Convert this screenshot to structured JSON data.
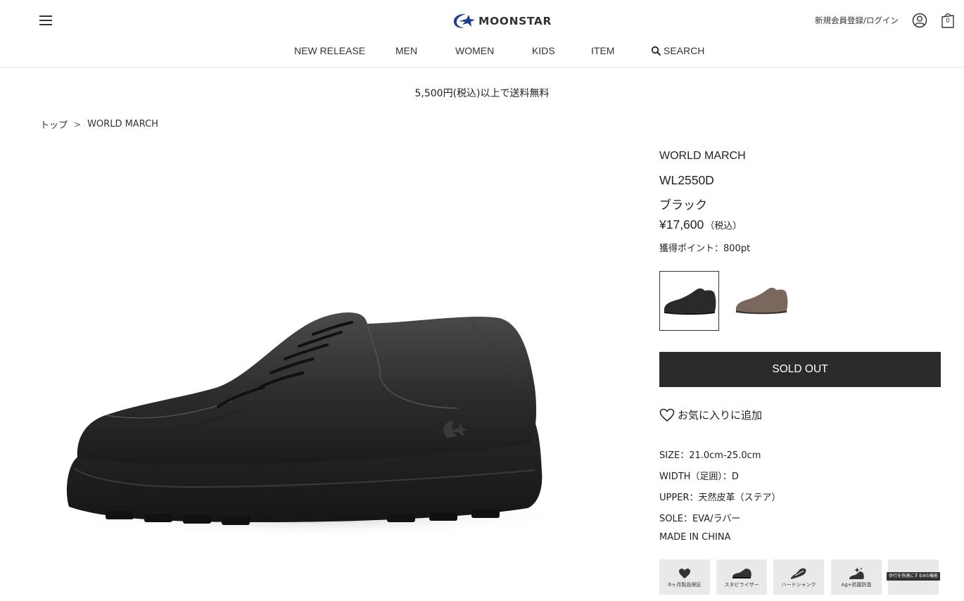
{
  "header": {
    "logo_text": "moonstar",
    "login_label": "新規会員登録/ログイン",
    "cart_count": "0",
    "brand_color": "#1d3f95"
  },
  "nav": {
    "items": [
      "NEW RELEASE",
      "MEN",
      "WOMEN",
      "KIDS",
      "ITEM",
      "SEARCH"
    ]
  },
  "banner": {
    "text": "5,500円(税込)以上で送料無料"
  },
  "breadcrumb": {
    "home": "トップ",
    "separator": ">",
    "current": "WORLD MARCH"
  },
  "product": {
    "brand": "WORLD MARCH",
    "model": "WL2550D",
    "color": "ブラック",
    "price": "¥17,600",
    "price_tax": "（税込）",
    "points": "獲得ポイント：800pt",
    "swatches": [
      {
        "name": "black",
        "color": "#2a2a2a",
        "selected": true
      },
      {
        "name": "bronze",
        "color": "#7a685e",
        "selected": false
      }
    ],
    "button_label": "SOLD OUT",
    "favorite_label": "お気に入りに追加",
    "specs": [
      "SIZE：21.0cm-25.0cm",
      "WIDTH（足囲）：D",
      "UPPER：天然皮革（ステア）",
      "SOLE：EVA/ラバー",
      "MADE IN CHINA"
    ],
    "features": [
      {
        "label": "6ヶ月製品保証",
        "icon": "heart-icon"
      },
      {
        "label": "スタビライザー",
        "icon": "shoe-stabilizer-icon"
      },
      {
        "label": "ハードシャンク",
        "icon": "shoe-shank-icon"
      },
      {
        "label": "Ag+抗菌防臭",
        "icon": "antibacterial-icon"
      },
      {
        "label": "歩行を快適にする8の機能",
        "icon": "text-badge"
      }
    ]
  }
}
